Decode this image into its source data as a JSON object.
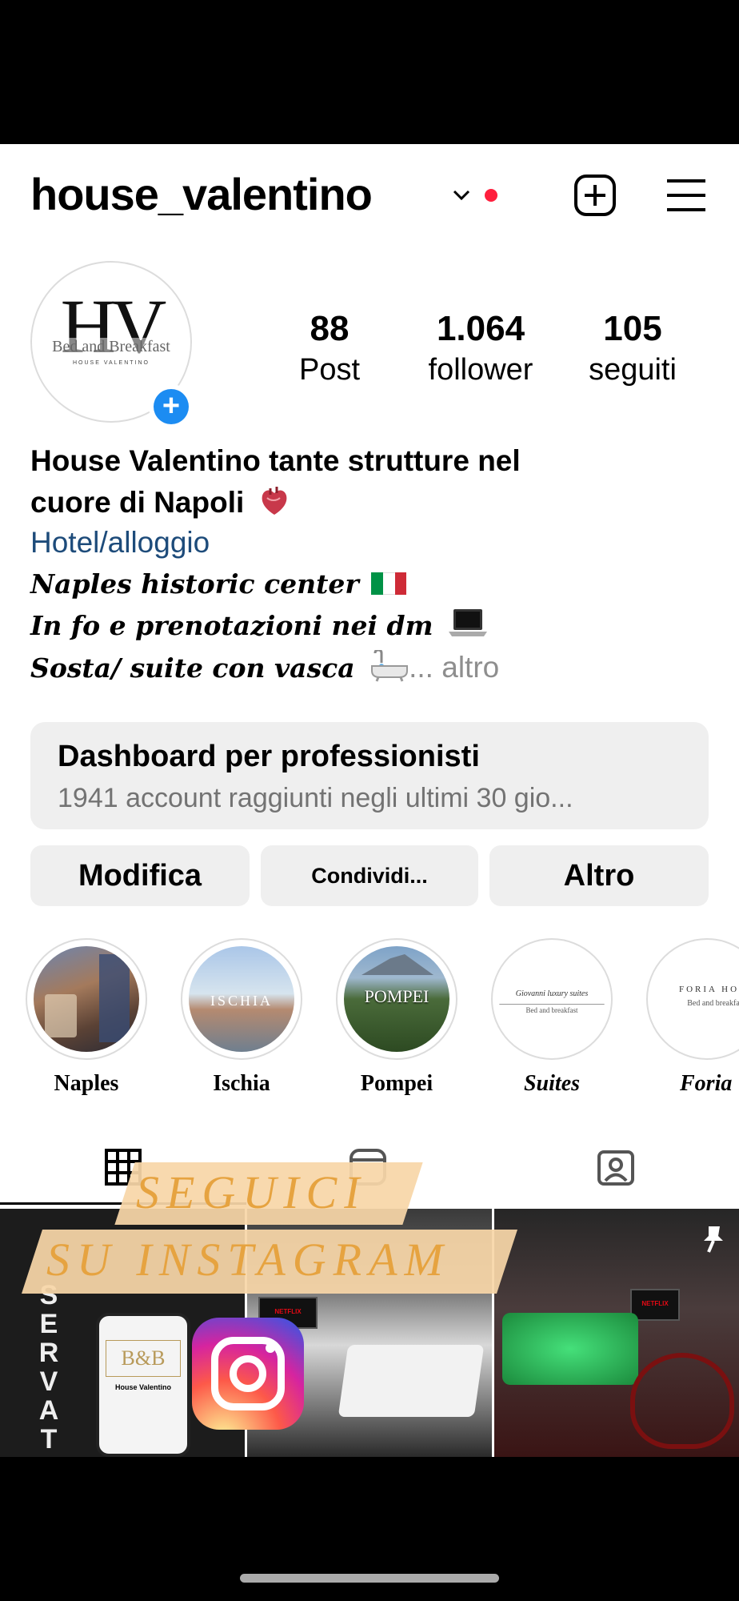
{
  "header": {
    "username": "house_valentino",
    "new_post_icon": "plus-square-icon",
    "menu_icon": "hamburger-menu-icon"
  },
  "profile": {
    "avatar_monogram": "HV",
    "avatar_tagline": "Bed and Breakfast",
    "avatar_subtitle": "HOUSE VALENTINO",
    "stats": [
      {
        "value": "88",
        "label": "Post"
      },
      {
        "value": "1.064",
        "label": "follower"
      },
      {
        "value": "105",
        "label": "seguiti"
      }
    ]
  },
  "bio": {
    "name_line1": "House Valentino tante strutture nel",
    "name_line2": "cuore di Napoli",
    "category": "Hotel/alloggio",
    "line1": "Naples historic center",
    "line2": "In fo e prenotazioni nei dm",
    "line3": "Sosta/ suite con vasca",
    "more": "... altro"
  },
  "dashboard": {
    "title": "Dashboard per professionisti",
    "subtitle": "1941 account raggiunti negli ultimi 30 gio..."
  },
  "buttons": {
    "edit": "Modifica",
    "share": "Condividi...",
    "more": "Altro"
  },
  "highlights": [
    {
      "label": "Naples"
    },
    {
      "label": "Ischia",
      "overlay": "ISCHIA"
    },
    {
      "label": "Pompei",
      "overlay": "POMPEI"
    },
    {
      "label": "Suites",
      "overlay_line1": "Giovanni luxury suites",
      "overlay_line2": "Bed and breakfast"
    },
    {
      "label": "Foria",
      "overlay_line1": "FORIA HOU",
      "overlay_line2": "Bed and breakfa"
    }
  ],
  "tabs": [
    "grid-icon",
    "reels-icon",
    "tagged-icon"
  ],
  "overlay": {
    "line1": "SEGUICI",
    "line2": "SU INSTAGRAM",
    "vertical_text": "SERVATIO",
    "phone_title": "B&B",
    "phone_name": "House Valentino",
    "tv_label": "NETFLIX"
  },
  "colors": {
    "accent_blue": "#1c8cf2",
    "category_blue": "#1d4b7a",
    "notification_red": "#ff1f3d",
    "banner_bg": "#f7d6a8",
    "banner_text": "#e6a340"
  }
}
